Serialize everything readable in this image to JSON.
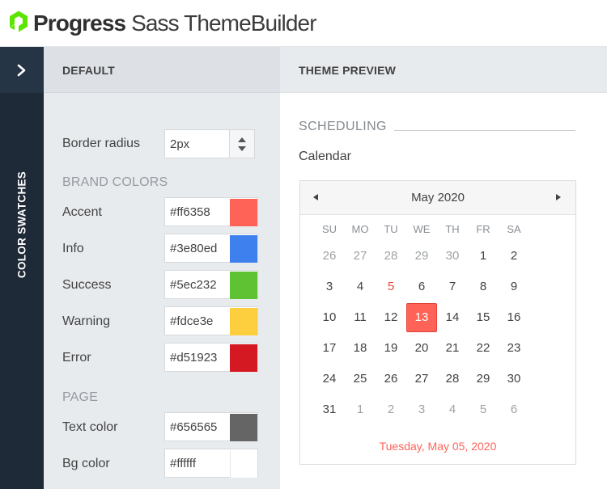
{
  "header": {
    "brand_strong": "Progress",
    "brand_rest": "Sass ThemeBuilder"
  },
  "sidebar": {
    "toggle_icon": "chevron-right-icon",
    "label": "COLOR SWATCHES"
  },
  "panel": {
    "title": "DEFAULT",
    "border_radius": {
      "label": "Border radius",
      "value": "2px"
    },
    "brand_colors_heading": "BRAND COLORS",
    "brand_colors": [
      {
        "label": "Accent",
        "hex": "#ff6358",
        "color": "#ff6358"
      },
      {
        "label": "Info",
        "hex": "#3e80ed",
        "color": "#3e80ed"
      },
      {
        "label": "Success",
        "hex": "#5ec232",
        "color": "#5ec232"
      },
      {
        "label": "Warning",
        "hex": "#fdce3e",
        "color": "#fdce3e"
      },
      {
        "label": "Error",
        "hex": "#d51923",
        "color": "#d51923"
      }
    ],
    "page_heading": "PAGE",
    "page_colors": [
      {
        "label": "Text color",
        "hex": "#656565",
        "color": "#656565"
      },
      {
        "label": "Bg color",
        "hex": "#ffffff",
        "color": "#ffffff"
      }
    ]
  },
  "preview": {
    "title": "THEME PREVIEW",
    "section": "SCHEDULING",
    "widget_title": "Calendar",
    "calendar": {
      "month_label": "May 2020",
      "weekdays": [
        "SU",
        "MO",
        "TU",
        "WE",
        "TH",
        "FR",
        "SA"
      ],
      "weeks": [
        [
          {
            "d": "26",
            "o": true
          },
          {
            "d": "27",
            "o": true
          },
          {
            "d": "28",
            "o": true
          },
          {
            "d": "29",
            "o": true
          },
          {
            "d": "30",
            "o": true
          },
          {
            "d": "1"
          },
          {
            "d": "2"
          }
        ],
        [
          {
            "d": "3"
          },
          {
            "d": "4"
          },
          {
            "d": "5",
            "today": true
          },
          {
            "d": "6"
          },
          {
            "d": "7"
          },
          {
            "d": "8"
          },
          {
            "d": "9"
          }
        ],
        [
          {
            "d": "10"
          },
          {
            "d": "11"
          },
          {
            "d": "12"
          },
          {
            "d": "13",
            "selected": true
          },
          {
            "d": "14"
          },
          {
            "d": "15"
          },
          {
            "d": "16"
          }
        ],
        [
          {
            "d": "17"
          },
          {
            "d": "18"
          },
          {
            "d": "19"
          },
          {
            "d": "20"
          },
          {
            "d": "21"
          },
          {
            "d": "22"
          },
          {
            "d": "23"
          }
        ],
        [
          {
            "d": "24"
          },
          {
            "d": "25"
          },
          {
            "d": "26"
          },
          {
            "d": "27"
          },
          {
            "d": "28"
          },
          {
            "d": "29"
          },
          {
            "d": "30"
          }
        ],
        [
          {
            "d": "31"
          },
          {
            "d": "1",
            "o": true
          },
          {
            "d": "2",
            "o": true
          },
          {
            "d": "3",
            "o": true
          },
          {
            "d": "4",
            "o": true
          },
          {
            "d": "5",
            "o": true
          },
          {
            "d": "6",
            "o": true
          }
        ]
      ],
      "footer_date": "Tuesday, May 05, 2020",
      "accent_color": "#ff6358"
    }
  }
}
